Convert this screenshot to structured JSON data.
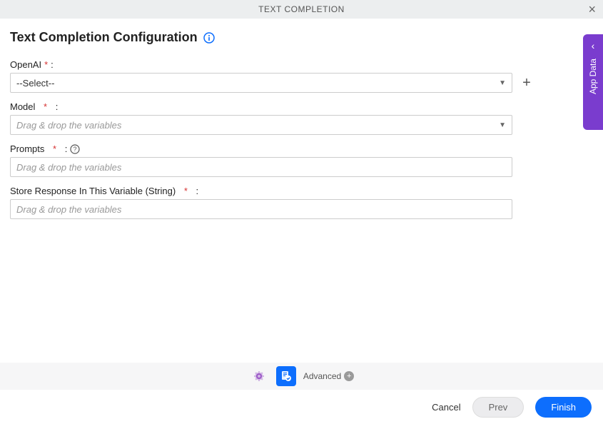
{
  "header": {
    "title": "TEXT COMPLETION"
  },
  "page": {
    "title": "Text Completion Configuration"
  },
  "fields": {
    "openai": {
      "label": "OpenAI",
      "required": "*",
      "colon": ":",
      "value": "--Select--"
    },
    "model": {
      "label": "Model",
      "required": "*",
      "colon": ":",
      "placeholder": "Drag & drop the variables"
    },
    "prompts": {
      "label": "Prompts",
      "required": "*",
      "colon": ":",
      "placeholder": "Drag & drop the variables"
    },
    "storeResponse": {
      "label": "Store Response In This Variable (String)",
      "required": "*",
      "colon": ":",
      "placeholder": "Drag & drop the variables"
    }
  },
  "toolbar": {
    "advanced": "Advanced"
  },
  "footer": {
    "cancel": "Cancel",
    "prev": "Prev",
    "finish": "Finish"
  },
  "sidebar": {
    "label": "App Data"
  }
}
